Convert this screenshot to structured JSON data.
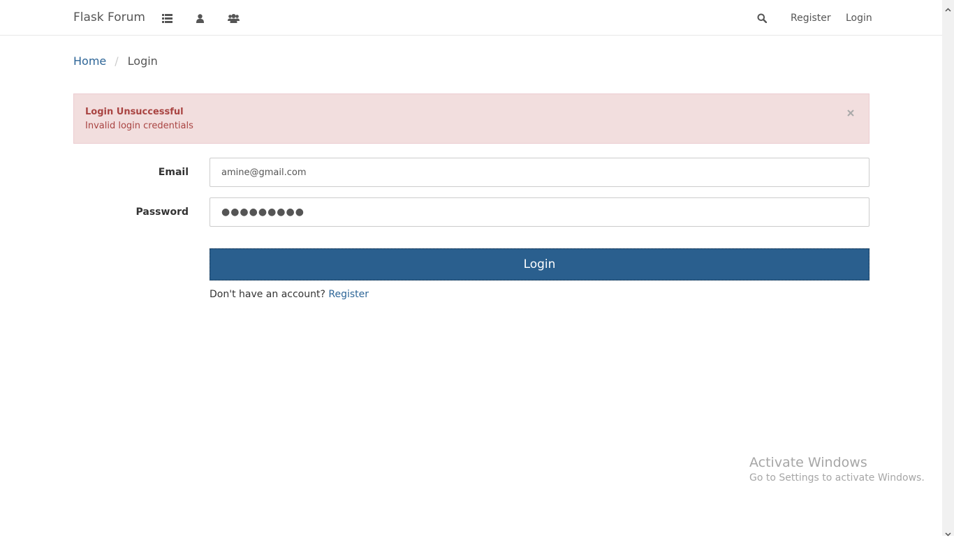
{
  "navbar": {
    "brand": "Flask Forum",
    "icons": [
      "list-icon",
      "user-icon",
      "users-icon",
      "search-icon"
    ],
    "register_label": "Register",
    "login_label": "Login"
  },
  "breadcrumb": {
    "home": "Home",
    "separator": "/",
    "current": "Login"
  },
  "alert": {
    "title": "Login Unsuccessful",
    "message": "Invalid login credentials",
    "background": "#f2dede",
    "text_color": "#a94442"
  },
  "form": {
    "email_label": "Email",
    "email_value": "amine@gmail.com",
    "password_label": "Password",
    "password_value": "●●●●●●●●●",
    "login_button": "Login",
    "signup_prompt": "Don't have an account?",
    "signup_link": "Register",
    "button_color": "#2a5f8e",
    "link_color": "#2d6597"
  },
  "watermark": {
    "title": "Activate Windows",
    "subtitle": "Go to Settings to activate Windows."
  }
}
